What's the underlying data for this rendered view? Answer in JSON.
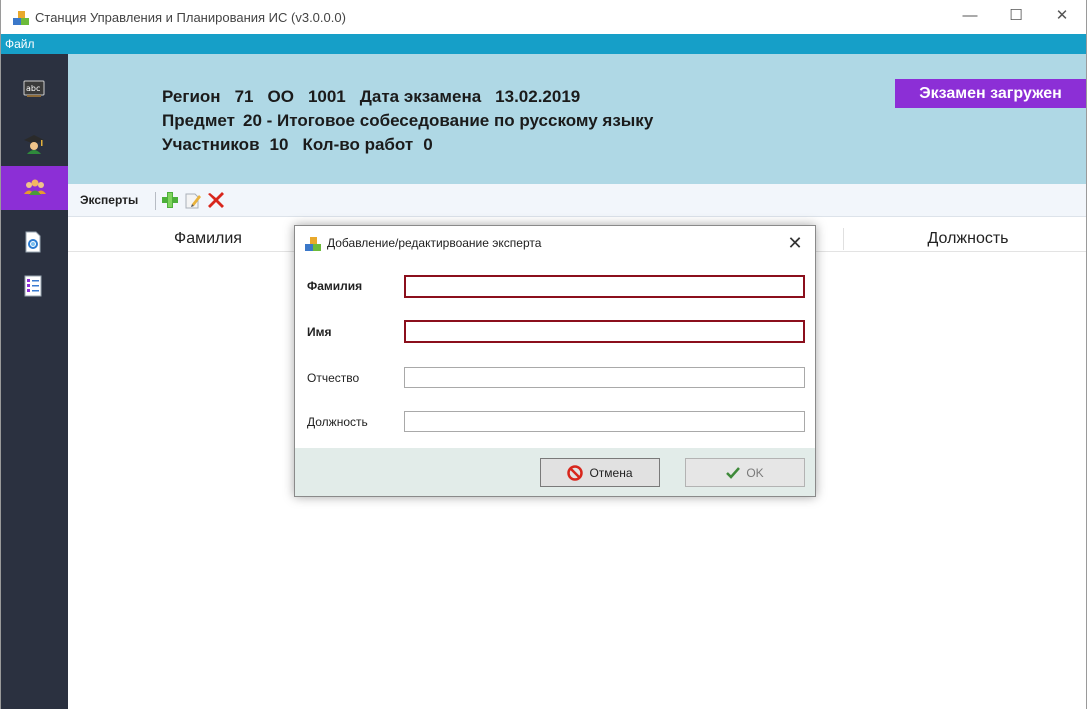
{
  "window": {
    "title": "Станция Управления и Планирования ИС (v3.0.0.0)",
    "minimize_glyph": "—",
    "maximize_glyph": "☐",
    "close_glyph": "✕"
  },
  "menu": {
    "file_label": "Файл"
  },
  "sidebar": {
    "items": [
      {
        "icon": "abc-icon",
        "active": false
      },
      {
        "icon": "graduate-icon",
        "active": false
      },
      {
        "icon": "experts-group-icon",
        "active": true
      },
      {
        "icon": "document-search-icon",
        "active": false
      },
      {
        "icon": "checklist-icon",
        "active": false
      }
    ]
  },
  "header": {
    "region_label": "Регион",
    "region_value": "71",
    "oo_label": "ОО",
    "oo_value": "1001",
    "exam_date_label": "Дата экзамена",
    "exam_date_value": "13.02.2019",
    "subject_label": "Предмет",
    "subject_value": "20 - Итоговое собеседование по русскому языку",
    "participants_label": "Участников",
    "participants_value": "10",
    "works_label": "Кол-во работ",
    "works_value": "0",
    "status_badge": "Экзамен загружен"
  },
  "toolbar": {
    "label": "Эксперты",
    "icons": [
      "add-icon",
      "edit-icon",
      "delete-icon"
    ]
  },
  "table": {
    "columns": [
      "Фамилия",
      "Должность"
    ]
  },
  "dialog": {
    "title": "Добавление/редактирвоание эксперта",
    "close_glyph": "✕",
    "fields": {
      "surname_label": "Фамилия",
      "surname_value": "",
      "name_label": "Имя",
      "name_value": "",
      "patronymic_label": "Отчество",
      "patronymic_value": "",
      "position_label": "Должность",
      "position_value": ""
    },
    "cancel_label": "Отмена",
    "ok_label": "OK"
  },
  "colors": {
    "menu_bar": "#169fc8",
    "sidebar": "#2b3140",
    "accent_purple": "#8c2fd6",
    "header_panel": "#afd8e5",
    "required_border": "#8b0f1c",
    "dialog_footer": "#e2ece9"
  }
}
